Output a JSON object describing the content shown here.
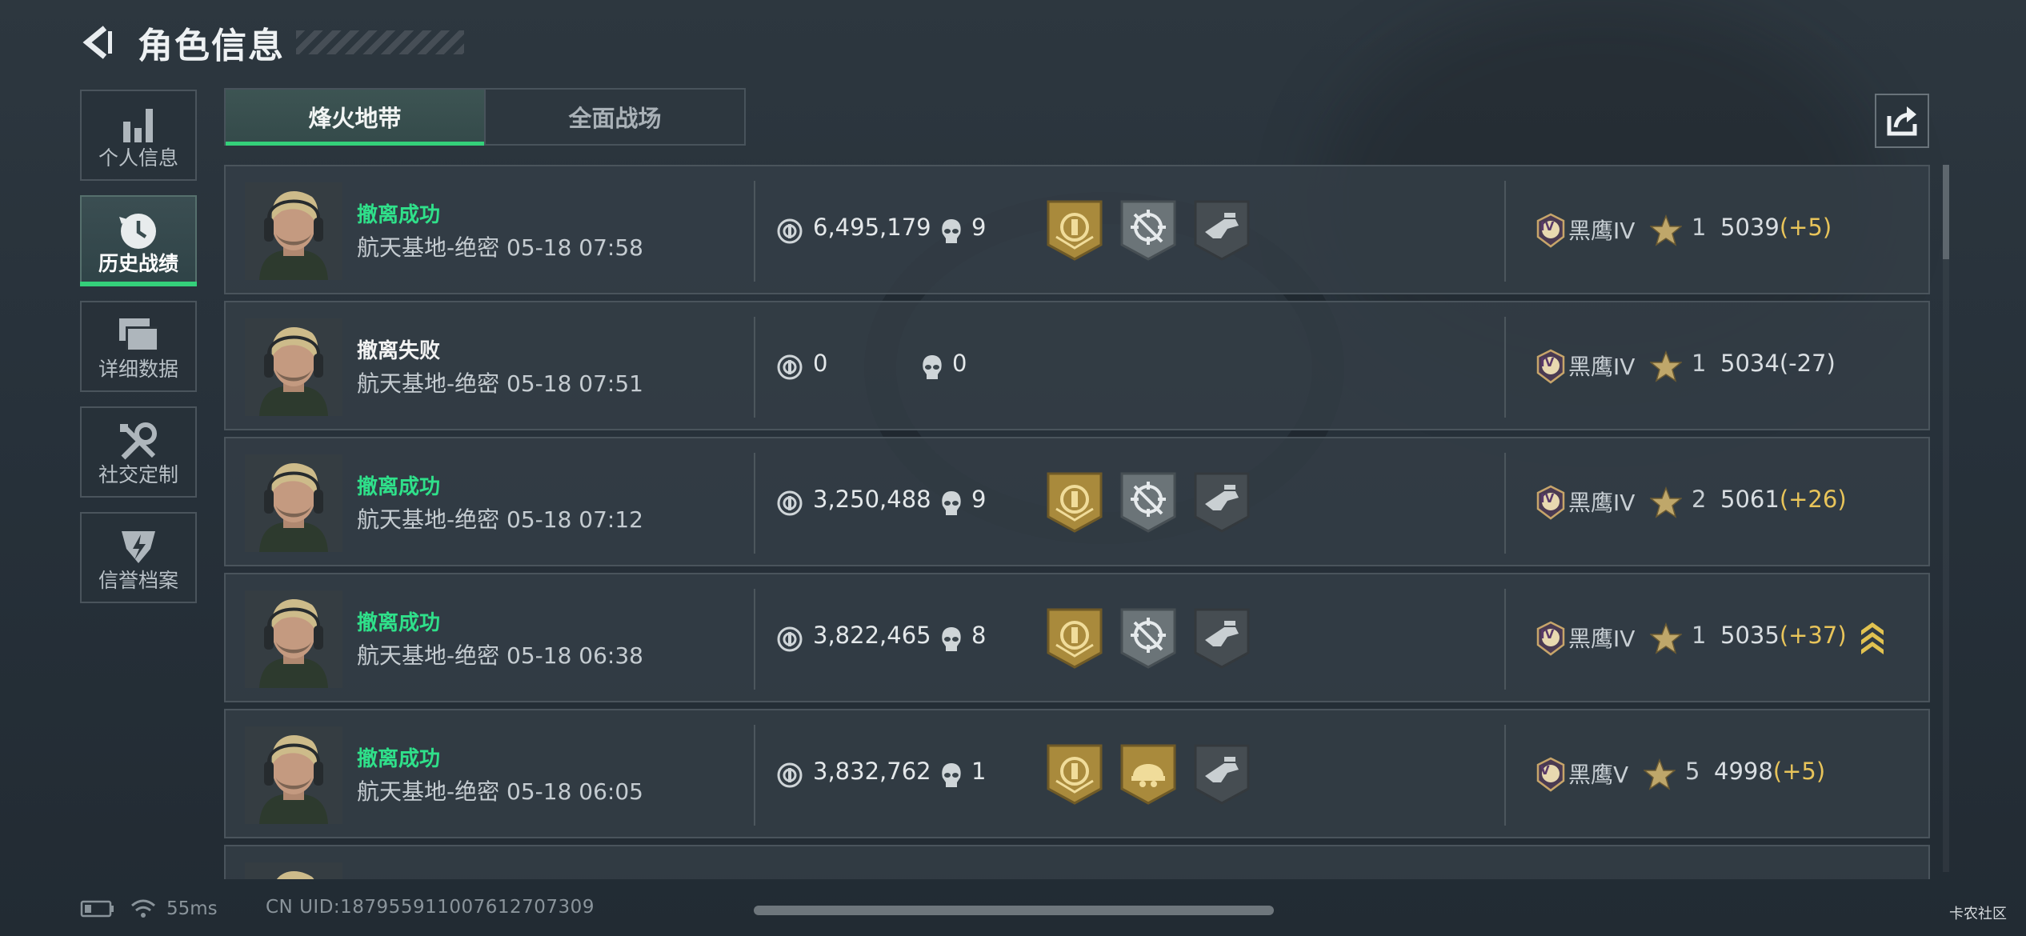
{
  "header": {
    "title": "角色信息"
  },
  "sidebar": {
    "items": [
      {
        "label": "个人信息",
        "icon": "bar-chart-icon",
        "active": false
      },
      {
        "label": "历史战绩",
        "icon": "history-clock-icon",
        "active": true
      },
      {
        "label": "详细数据",
        "icon": "folder-stack-icon",
        "active": false
      },
      {
        "label": "社交定制",
        "icon": "tools-icon",
        "active": false
      },
      {
        "label": "信誉档案",
        "icon": "reputation-badge-icon",
        "active": false
      }
    ]
  },
  "tabs": [
    {
      "label": "烽火地带",
      "active": true
    },
    {
      "label": "全面战场",
      "active": false
    }
  ],
  "matches": [
    {
      "result": "撤离成功",
      "success": true,
      "map": "航天基地-绝密",
      "time": "05-18 07:58",
      "money": "6,495,179",
      "kills": "9",
      "badges": [
        "gold-extract-badge-icon",
        "silver-crosshair-badge-icon",
        "dark-gun-badge-icon"
      ],
      "rank": "黑鹰IV",
      "rank_numeral": "IV",
      "stars": "1",
      "score": "5039",
      "delta": "(+5)",
      "delta_positive": true,
      "promoted": false
    },
    {
      "result": "撤离失败",
      "success": false,
      "map": "航天基地-绝密",
      "time": "05-18 07:51",
      "money": "0",
      "kills": "0",
      "badges": [],
      "rank": "黑鹰IV",
      "rank_numeral": "IV",
      "stars": "1",
      "score": "5034",
      "delta": "(-27)",
      "delta_positive": false,
      "promoted": false
    },
    {
      "result": "撤离成功",
      "success": true,
      "map": "航天基地-绝密",
      "time": "05-18 07:12",
      "money": "3,250,488",
      "kills": "9",
      "badges": [
        "gold-extract-badge-icon",
        "silver-crosshair-badge-icon",
        "dark-gun-badge-icon"
      ],
      "rank": "黑鹰IV",
      "rank_numeral": "IV",
      "stars": "2",
      "score": "5061",
      "delta": "(+26)",
      "delta_positive": true,
      "promoted": false
    },
    {
      "result": "撤离成功",
      "success": true,
      "map": "航天基地-绝密",
      "time": "05-18 06:38",
      "money": "3,822,465",
      "kills": "8",
      "badges": [
        "gold-extract-badge-icon",
        "silver-crosshair-badge-icon",
        "dark-gun-badge-icon"
      ],
      "rank": "黑鹰IV",
      "rank_numeral": "IV",
      "stars": "1",
      "score": "5035",
      "delta": "(+37)",
      "delta_positive": true,
      "promoted": true
    },
    {
      "result": "撤离成功",
      "success": true,
      "map": "航天基地-绝密",
      "time": "05-18 06:05",
      "money": "3,832,762",
      "kills": "1",
      "badges": [
        "gold-extract-badge-icon",
        "gold-helmet-badge-icon",
        "dark-gun-badge-icon"
      ],
      "rank": "黑鹰V",
      "rank_numeral": "V",
      "stars": "5",
      "score": "4998",
      "delta": "(+5)",
      "delta_positive": true,
      "promoted": false
    }
  ],
  "status_bar": {
    "ping": "55ms",
    "uid": "CN UID:187955911007612707309"
  },
  "watermark": "卡农社区",
  "colors": {
    "success": "#2fe08a",
    "accent": "#34d07a",
    "gain": "#e8c45a",
    "gold_badge": "#a98a3c"
  }
}
